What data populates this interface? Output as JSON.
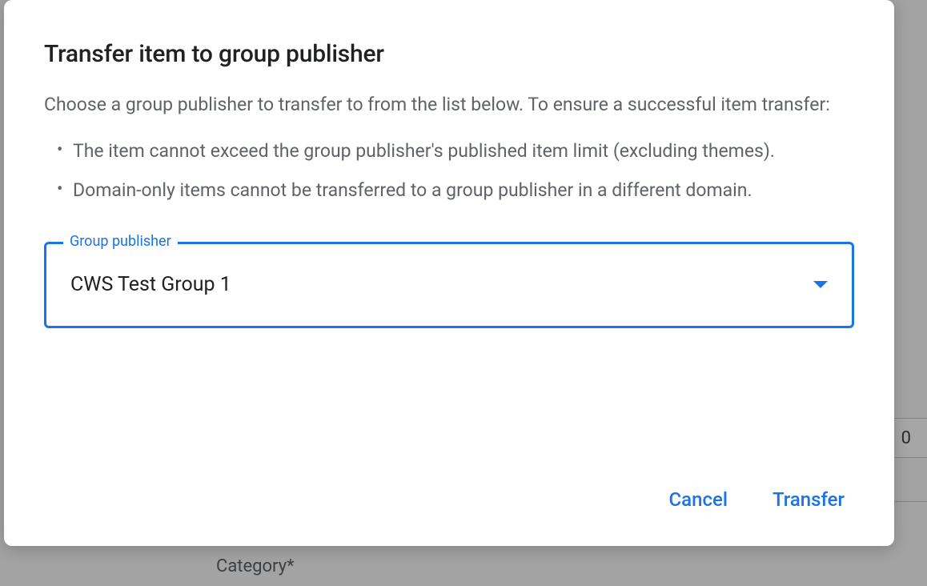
{
  "dialog": {
    "title": "Transfer item to group publisher",
    "description": "Choose a group publisher to transfer to from the list below. To ensure a successful item transfer:",
    "bullets": [
      "The item cannot exceed the group publisher's published item limit (excluding themes).",
      "Domain-only items cannot be transferred to a group publisher in a different domain."
    ],
    "select": {
      "label": "Group publisher",
      "value": "CWS Test Group 1"
    },
    "actions": {
      "cancel": "Cancel",
      "transfer": "Transfer"
    }
  },
  "backdrop": {
    "field_value": "0",
    "category_label": "Category*"
  }
}
